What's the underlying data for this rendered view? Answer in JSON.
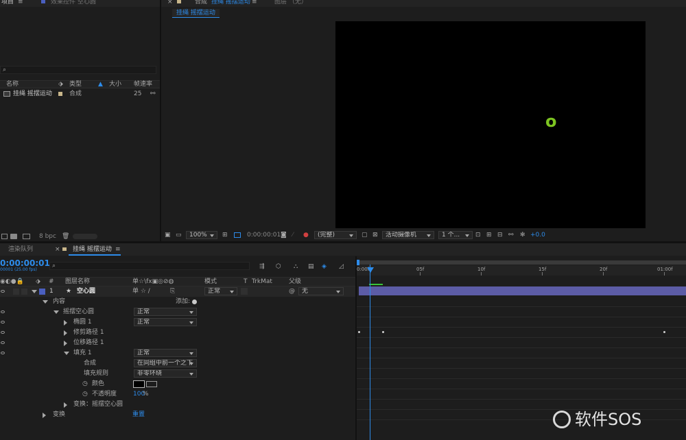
{
  "project_panel": {
    "tab_label": "项目",
    "tab2_label": "效果控件 空心圆",
    "search_placeholder": "",
    "columns": [
      "名称",
      "类型",
      "大小",
      "帧速率"
    ],
    "items": [
      {
        "name": "挂绳 摇摆运动",
        "type": "合成",
        "fps": "25"
      }
    ],
    "bpc_label": "8 bpc"
  },
  "comp_panel": {
    "tab_label": "合成",
    "comp_name": "挂绳 摇摆运动",
    "layer_tab_label": "图层 （无）",
    "subtab_label": "挂绳 摇摆运动",
    "zoom": "100%",
    "timecode": "0:00:00:01",
    "quality": "(完整)",
    "camera": "活动摄像机",
    "views": "1 个...",
    "exposure": "+0.0",
    "shape_glyph": "o",
    "shape_color": "#7dc421"
  },
  "timeline": {
    "render_queue_tab": "渲染队列",
    "comp_tab": "挂绳 摇摆运动",
    "timecode": "0:00:00:01",
    "timecode_sub": "00001 (25.00 fps)",
    "search_placeholder": "",
    "columns": {
      "num": "#",
      "name": "图层名称",
      "switches": "单☆\\fx▣◎⊘◍",
      "mode": "模式",
      "t": "T",
      "trkmat": "TrkMat",
      "parent": "父级"
    },
    "layer": {
      "index": "1",
      "name": "空心圆",
      "mode": "正常",
      "parent": "无"
    },
    "rows": [
      {
        "label": "内容",
        "indent": 1,
        "expanded": true,
        "right_label": "添加:"
      },
      {
        "label": "摇摆空心圆",
        "indent": 2,
        "expanded": true,
        "mode": "正常"
      },
      {
        "label": "椭圆 1",
        "indent": 3,
        "expanded": false,
        "mode": "正常"
      },
      {
        "label": "修剪路径 1",
        "indent": 3,
        "expanded": false
      },
      {
        "label": "位移路径 1",
        "indent": 3,
        "expanded": false
      },
      {
        "label": "填充 1",
        "indent": 3,
        "expanded": true,
        "mode": "正常"
      },
      {
        "label": "合成",
        "indent": 4,
        "value": "在同组中前一个之下"
      },
      {
        "label": "填充规则",
        "indent": 4,
        "value": "非零环绕"
      },
      {
        "label": "颜色",
        "indent": 4,
        "stopwatch": true
      },
      {
        "label": "不透明度",
        "indent": 4,
        "stopwatch": true,
        "number": "100",
        "unit": "%"
      },
      {
        "label": "变换：摇摆空心圆",
        "indent": 3,
        "expanded": false
      },
      {
        "label": "变换",
        "indent": 1,
        "expanded": false,
        "link": "重置"
      }
    ],
    "ruler_labels": [
      "0:00f",
      "05f",
      "10f",
      "15f",
      "20f",
      "01:00f"
    ]
  },
  "watermark": {
    "text": "软件SOS"
  }
}
